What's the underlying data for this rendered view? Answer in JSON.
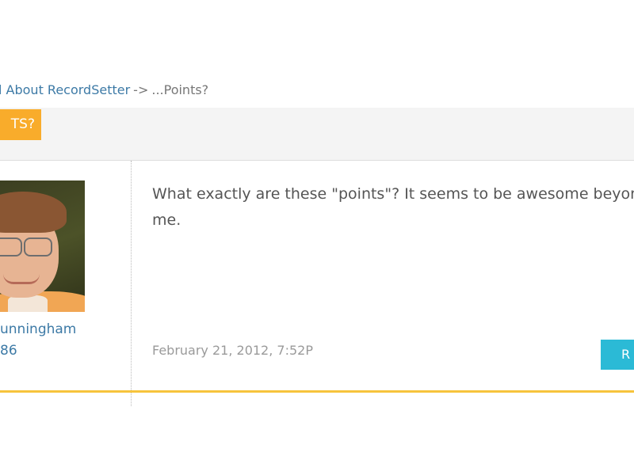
{
  "breadcrumb": {
    "parent_label": "l About RecordSetter",
    "separator": "->",
    "current": "...Points?"
  },
  "thread": {
    "title_badge": "TS?"
  },
  "post": {
    "author_name": "unningham",
    "author_points": "86",
    "body": "What exactly are these \"points\"? It seems to be awesome beyond me.",
    "date": "February 21, 2012, 7:52P",
    "reply_label": "R"
  },
  "colors": {
    "accent_orange": "#f9ac2b",
    "link_blue": "#3d7aa6",
    "reply_cyan": "#2bbad6",
    "divider_yellow": "#f7c43c"
  }
}
